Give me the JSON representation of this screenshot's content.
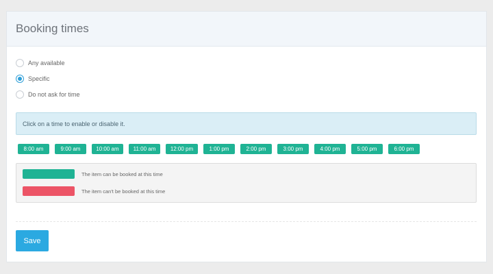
{
  "header": {
    "title": "Booking times"
  },
  "options": [
    {
      "label": "Any available",
      "checked": false
    },
    {
      "label": "Specific",
      "checked": true
    },
    {
      "label": "Do not ask for time",
      "checked": false
    }
  ],
  "info": {
    "text": "Click on a time to enable or disable it."
  },
  "times": [
    "8:00 am",
    "9:00 am",
    "10:00 am",
    "11:00 am",
    "12:00 pm",
    "1:00 pm",
    "2:00 pm",
    "3:00 pm",
    "4:00 pm",
    "5:00 pm",
    "6:00 pm"
  ],
  "legend": [
    {
      "text": "The item can be booked at this time",
      "color": "#1fb394"
    },
    {
      "text": "The item can't be booked at this time",
      "color": "#ec5466"
    }
  ],
  "actions": {
    "save_label": "Save"
  },
  "colors": {
    "enabled": "#1fb394",
    "disabled": "#ec5466",
    "accent": "#2ba9e1"
  }
}
